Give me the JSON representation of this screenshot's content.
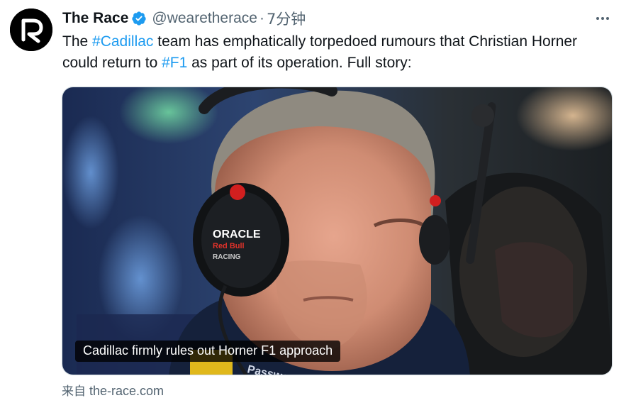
{
  "tweet": {
    "display_name": "The Race",
    "handle": "@wearetherace",
    "separator": "·",
    "time": "7分钟",
    "verified": true,
    "text": {
      "part1": "The ",
      "hashtag1": "#Cadillac",
      "part2": " team has emphatically torpedoed rumours that Christian Horner could return to ",
      "hashtag2": "#F1",
      "part3": " as part of its operation. Full story:"
    }
  },
  "card": {
    "caption": "Cadillac firmly rules out Horner F1 approach",
    "source_prefix": "来自",
    "source_domain": "the-race.com",
    "headset_brand": "ORACLE",
    "headset_sub": "Red Bull",
    "headset_racing": "RACING",
    "shirt_text": "Passwo"
  },
  "icons": {
    "avatar": "the-race-r-logo",
    "verified": "verified-badge-icon",
    "more": "more-options-icon"
  },
  "colors": {
    "accent": "#1d9bf0",
    "secondary_text": "#536471",
    "primary_text": "#0f1419"
  }
}
